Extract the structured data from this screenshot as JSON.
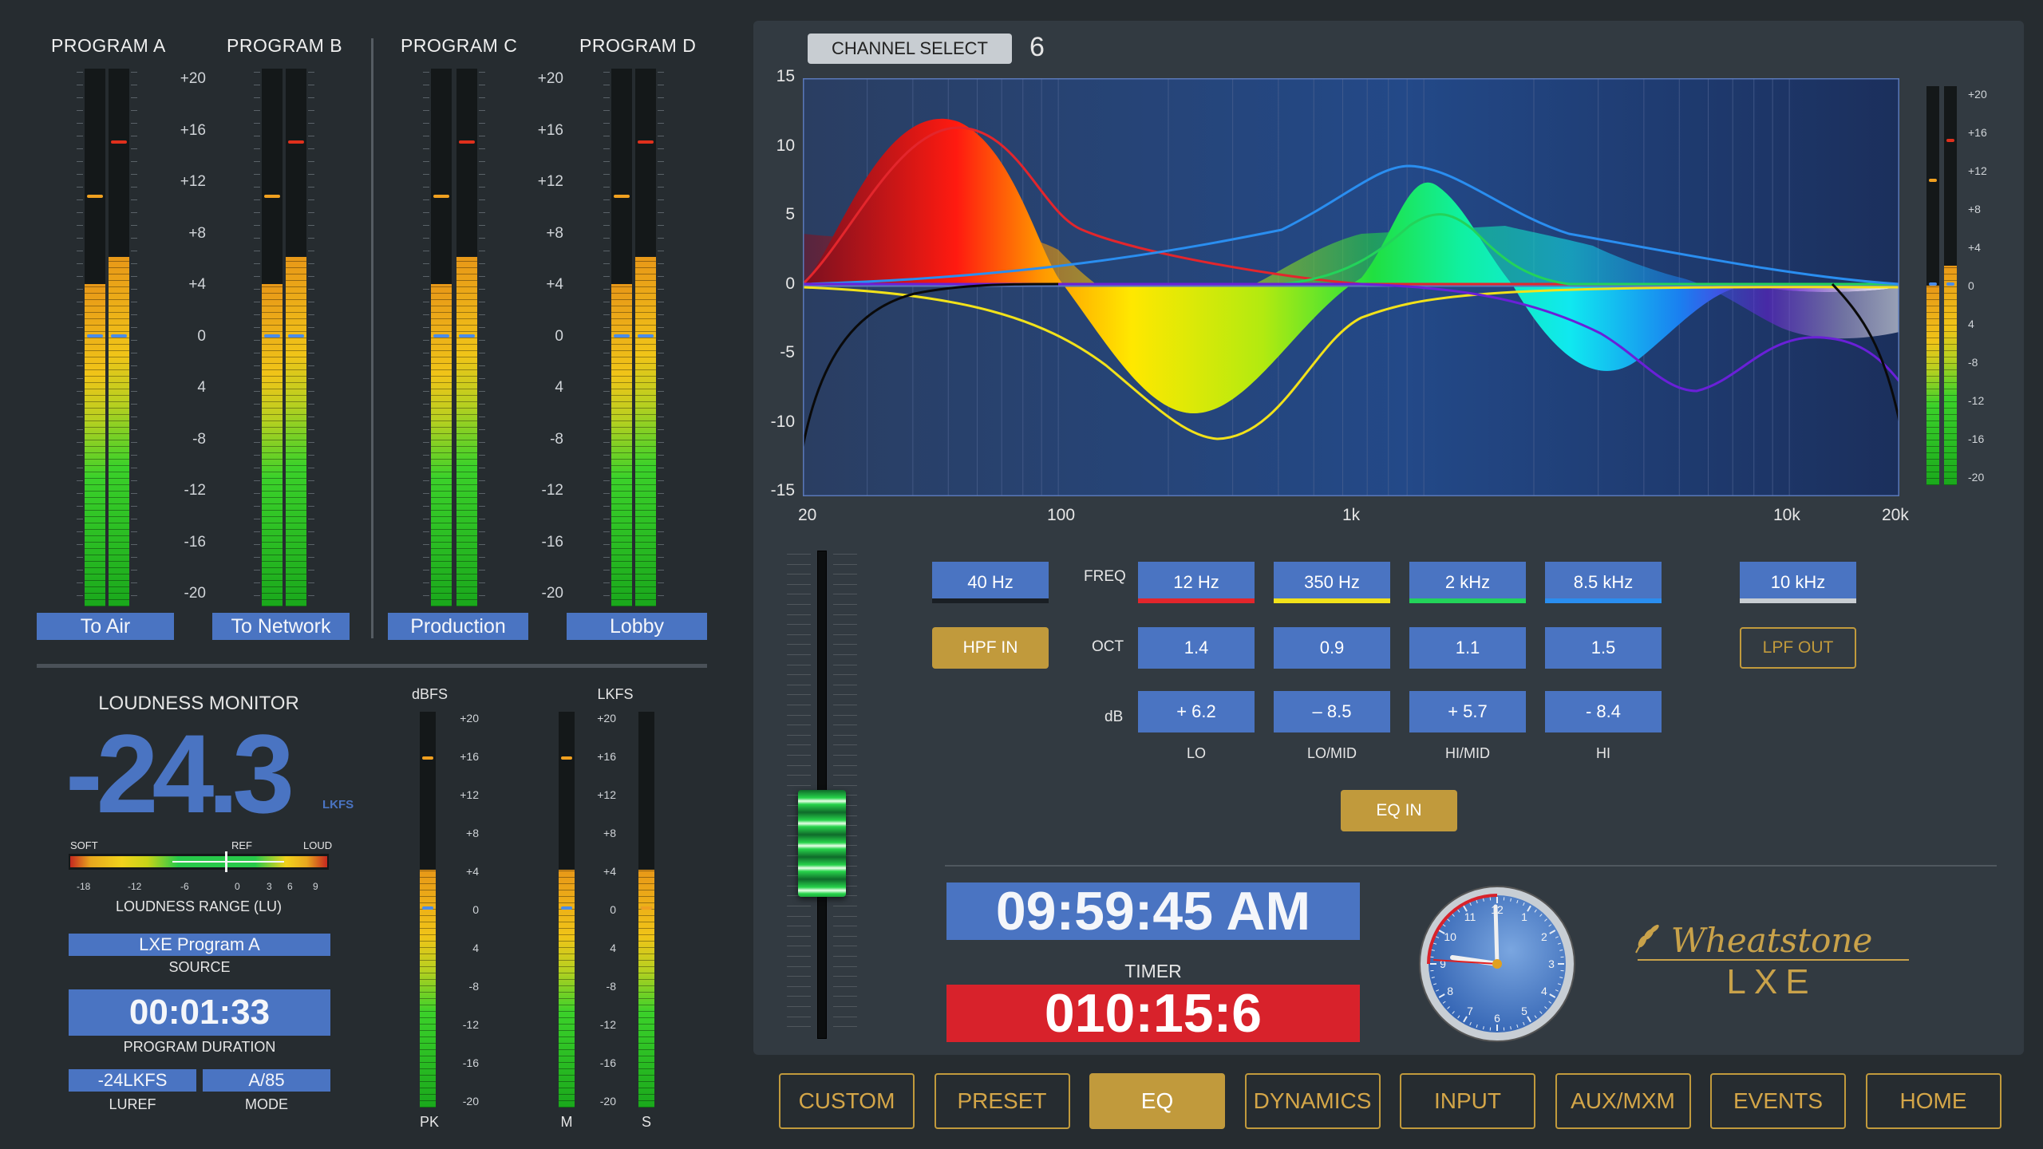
{
  "programs": [
    {
      "title": "PROGRAM A",
      "button": "To Air"
    },
    {
      "title": "PROGRAM B",
      "button": "To Network"
    },
    {
      "title": "PROGRAM C",
      "button": "Production"
    },
    {
      "title": "PROGRAM D",
      "button": "Lobby"
    }
  ],
  "meter_scale": [
    "+20",
    "+16",
    "+12",
    "+8",
    "+4",
    "0",
    "4",
    "-8",
    "-12",
    "-16",
    "-20"
  ],
  "loudness": {
    "title": "LOUDNESS MONITOR",
    "value": "-24.3",
    "unit": "LKFS",
    "range_soft": "SOFT",
    "range_ref": "REF",
    "range_loud": "LOUD",
    "range_ticks": [
      "-18",
      "-12",
      "-6",
      "0",
      "3",
      "6",
      "9"
    ],
    "range_label": "LOUDNESS RANGE (LU)",
    "source_value": "LXE Program A",
    "source_label": "SOURCE",
    "duration_value": "00:01:33",
    "duration_label": "PROGRAM DURATION",
    "luref_value": "-24LKFS",
    "luref_label": "LUREF",
    "mode_value": "A/85",
    "mode_label": "MODE"
  },
  "small_meters": {
    "dbfs_label": "dBFS",
    "lkfs_label": "LKFS",
    "pk_label": "PK",
    "m_label": "M",
    "s_label": "S"
  },
  "eq": {
    "channel_select_label": "CHANNEL SELECT",
    "channel_number": "6",
    "y_ticks": [
      "15",
      "10",
      "5",
      "0",
      "-5",
      "-10",
      "-15"
    ],
    "x_ticks": [
      "20",
      "100",
      "1k",
      "10k",
      "20k"
    ],
    "side_scale": [
      "+20",
      "+16",
      "+12",
      "+8",
      "+4",
      "0",
      "4",
      "-8",
      "-12",
      "-16",
      "-20"
    ],
    "hpf_freq": "40 Hz",
    "hpf_button": "HPF IN",
    "lpf_freq": "10 kHz",
    "lpf_button": "LPF OUT",
    "freq_label": "FREQ",
    "oct_label": "OCT",
    "db_label": "dB",
    "eq_in_button": "EQ IN",
    "bands": [
      {
        "name": "LO",
        "freq": "12 Hz",
        "oct": "1.4",
        "db": "+ 6.2",
        "color": "#e3262c"
      },
      {
        "name": "LO/MID",
        "freq": "350 Hz",
        "oct": "0.9",
        "db": "– 8.5",
        "color": "#f2e21a"
      },
      {
        "name": "HI/MID",
        "freq": "2 kHz",
        "oct": "1.1",
        "db": "+ 5.7",
        "color": "#23d35a"
      },
      {
        "name": "HI",
        "freq": "8.5 kHz",
        "oct": "1.5",
        "db": "- 8.4",
        "color": "#2a8ef0"
      }
    ]
  },
  "clock": {
    "time": "09:59:45 AM",
    "timer_label": "TIMER",
    "timer_value": "010:15:6",
    "dial_numbers": [
      "12",
      "1",
      "2",
      "3",
      "4",
      "5",
      "6",
      "7",
      "8",
      "9",
      "10",
      "11"
    ]
  },
  "brand": {
    "name": "Wheatstone",
    "model": "LXE"
  },
  "nav": [
    "CUSTOM",
    "PRESET",
    "EQ",
    "DYNAMICS",
    "INPUT",
    "AUX/MXM",
    "EVENTS",
    "HOME"
  ],
  "nav_active": "EQ",
  "colors": {
    "accent_blue": "#4a74c2",
    "accent_gold": "#c19a3c",
    "timer_red": "#d8222b"
  }
}
